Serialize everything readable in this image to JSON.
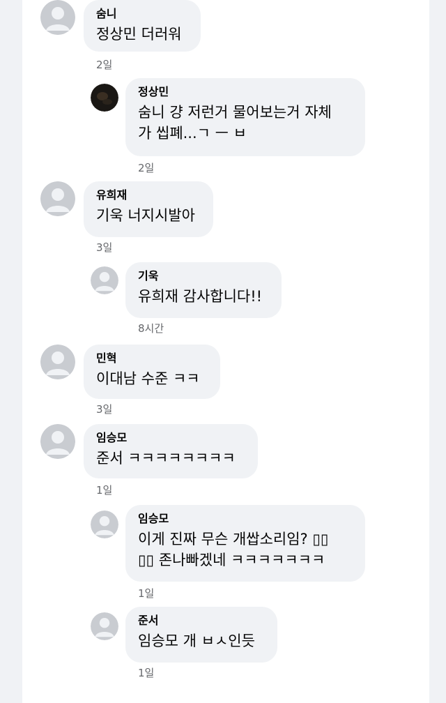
{
  "comments": [
    {
      "author": "숨니",
      "text": "정상민 더러워",
      "time": "2일",
      "avatar": "default-avatar"
    },
    {
      "author": "정상민",
      "text": "숨니 걍 저런거 물어보는거 자체\n가 씹폐...ㄱ ㅡ ㅂ",
      "time": "2일",
      "avatar": "dark-photo-avatar"
    },
    {
      "author": "유희재",
      "text": "기욱 너지시발아",
      "time": "3일",
      "avatar": "default-avatar"
    },
    {
      "author": "기욱",
      "text": "유희재 감사합니다!!",
      "time": "8시간",
      "avatar": "default-avatar"
    },
    {
      "author": "민혁",
      "text": "이대남 수준 ㅋㅋ",
      "time": "3일",
      "avatar": "default-avatar"
    },
    {
      "author": "임승모",
      "text": "준서 ㅋㅋㅋㅋㅋㅋㅋㅋ",
      "time": "1일",
      "avatar": "default-avatar"
    },
    {
      "author": "임승모",
      "text": "이게 진짜 무슨 개쌉소리임? ▯▯\n▯▯ 존나빠겠네 ㅋㅋㅋㅋㅋㅋㅋ",
      "time": "1일",
      "avatar": "default-avatar"
    },
    {
      "author": "준서",
      "text": "임승모 개 ㅂㅅ인듯",
      "time": "1일",
      "avatar": "default-avatar"
    }
  ],
  "colors": {
    "page_background": "#f0f2f5",
    "panel_background": "#ffffff",
    "bubble_background": "#f0f2f5",
    "author_text": "#050505",
    "timestamp_text": "#65676b",
    "default_avatar_bg": "#c9ccd1",
    "default_avatar_fg": "#f0f2f5"
  }
}
